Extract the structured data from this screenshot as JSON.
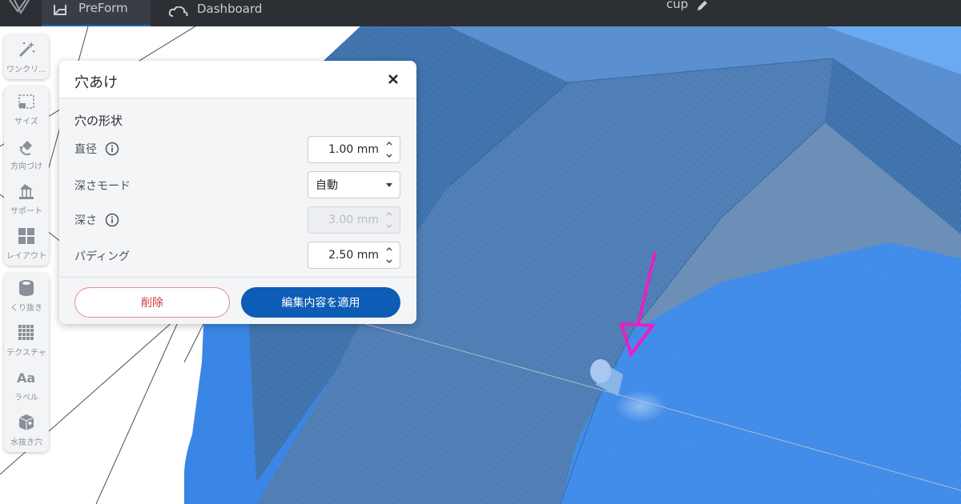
{
  "topbar": {
    "tabs": [
      {
        "label": "PreForm",
        "icon": "preform-icon"
      },
      {
        "label": "Dashboard",
        "icon": "cloud-icon"
      }
    ],
    "file_name": "cup"
  },
  "toolbar": {
    "group1": [
      {
        "label": "ワンクリ…",
        "icon": "magic-wand-icon"
      }
    ],
    "group2": [
      {
        "label": "サイズ",
        "icon": "scale-icon"
      },
      {
        "label": "方向づけ",
        "icon": "orientation-icon"
      },
      {
        "label": "サポート",
        "icon": "supports-icon"
      },
      {
        "label": "レイアウト",
        "icon": "layout-icon"
      }
    ],
    "group3": [
      {
        "label": "くり抜き",
        "icon": "hollow-icon"
      },
      {
        "label": "テクスチャ",
        "icon": "texture-icon"
      },
      {
        "label": "ラベル",
        "icon": "label-icon"
      },
      {
        "label": "水抜き穴",
        "icon": "drain-hole-icon"
      }
    ]
  },
  "dialog": {
    "title": "穴あけ",
    "section_title": "穴の形状",
    "fields": {
      "diameter": {
        "label": "直径",
        "value": "1.00 mm"
      },
      "depth_mode": {
        "label": "深さモード",
        "value": "自動"
      },
      "depth": {
        "label": "深さ",
        "value": "3.00 mm"
      },
      "padding": {
        "label": "パディング",
        "value": "2.50 mm"
      }
    },
    "delete_label": "削除",
    "apply_label": "編集内容を適用"
  },
  "colors": {
    "topbar_bg": "#2c3035",
    "model_blue": "#3a86e6",
    "apply_button": "#0d5cb6",
    "arrow_magenta": "#ea1fc6"
  }
}
